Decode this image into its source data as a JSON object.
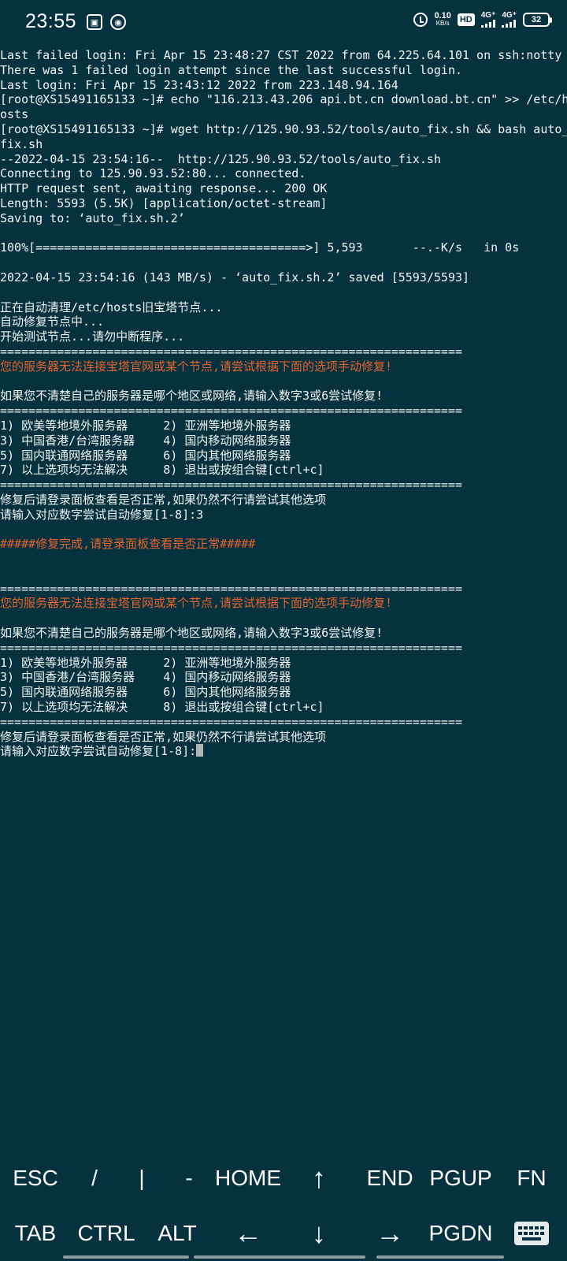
{
  "status_bar": {
    "time": "23:55",
    "net_speed_value": "0.10",
    "net_speed_unit": "KB/s",
    "hd_label": "HD",
    "sim1_label": "4G⁺",
    "sim2_label": "4G⁺",
    "battery": "32",
    "icons": [
      "image-notification-icon",
      "app-notification-icon",
      "alarm-icon",
      "hd-voice-icon",
      "signal-icon",
      "battery-icon"
    ]
  },
  "terminal": {
    "lines": [
      {
        "text": "Last failed login: Fri Apr 15 23:48:27 CST 2022 from 64.225.64.101 on ssh:notty",
        "color": "normal"
      },
      {
        "text": "There was 1 failed login attempt since the last successful login.",
        "color": "normal"
      },
      {
        "text": "Last login: Fri Apr 15 23:43:12 2022 from 223.148.94.164",
        "color": "normal"
      },
      {
        "text": "[root@XS15491165133 ~]# echo \"116.213.43.206 api.bt.cn download.bt.cn\" >> /etc/h",
        "color": "normal"
      },
      {
        "text": "osts",
        "color": "normal"
      },
      {
        "text": "[root@XS15491165133 ~]# wget http://125.90.93.52/tools/auto_fix.sh && bash auto_",
        "color": "normal"
      },
      {
        "text": "fix.sh",
        "color": "normal"
      },
      {
        "text": "--2022-04-15 23:54:16--  http://125.90.93.52/tools/auto_fix.sh",
        "color": "normal"
      },
      {
        "text": "Connecting to 125.90.93.52:80... connected.",
        "color": "normal"
      },
      {
        "text": "HTTP request sent, awaiting response... 200 OK",
        "color": "normal"
      },
      {
        "text": "Length: 5593 (5.5K) [application/octet-stream]",
        "color": "normal"
      },
      {
        "text": "Saving to: ‘auto_fix.sh.2’",
        "color": "normal"
      },
      {
        "text": "",
        "color": "normal"
      },
      {
        "text": "100%[======================================>] 5,593       --.-K/s   in 0s",
        "color": "normal"
      },
      {
        "text": "",
        "color": "normal"
      },
      {
        "text": "2022-04-15 23:54:16 (143 MB/s) - ‘auto_fix.sh.2’ saved [5593/5593]",
        "color": "normal"
      },
      {
        "text": "",
        "color": "normal"
      },
      {
        "text": "正在自动清理/etc/hosts旧宝塔节点...",
        "color": "normal"
      },
      {
        "text": "自动修复节点中...",
        "color": "normal"
      },
      {
        "text": "开始测试节点...请勿中断程序...",
        "color": "normal"
      },
      {
        "text": "=================================================================",
        "color": "normal"
      },
      {
        "text": "您的服务器无法连接宝塔官网或某个节点,请尝试根据下面的选项手动修复!",
        "color": "orange"
      },
      {
        "text": "",
        "color": "normal"
      },
      {
        "text": "如果您不清楚自己的服务器是哪个地区或网络,请输入数字3或6尝试修复!",
        "color": "normal"
      },
      {
        "text": "=================================================================",
        "color": "normal"
      },
      {
        "text": "1) 欧美等地境外服务器     2) 亚洲等地境外服务器",
        "color": "normal"
      },
      {
        "text": "3) 中国香港/台湾服务器    4) 国内移动网络服务器",
        "color": "normal"
      },
      {
        "text": "5) 国内联通网络服务器     6) 国内其他网络服务器",
        "color": "normal"
      },
      {
        "text": "7) 以上选项均无法解决     8) 退出或按组合键[ctrl+c]",
        "color": "normal"
      },
      {
        "text": "=================================================================",
        "color": "normal"
      },
      {
        "text": "修复后请登录面板查看是否正常,如果仍然不行请尝试其他选项",
        "color": "normal"
      },
      {
        "text": "请输入对应数字尝试自动修复[1-8]:3",
        "color": "normal"
      },
      {
        "text": "",
        "color": "normal"
      },
      {
        "text": "#####修复完成,请登录面板查看是否正常#####",
        "color": "orange"
      },
      {
        "text": "",
        "color": "normal"
      },
      {
        "text": "",
        "color": "normal"
      },
      {
        "text": "=================================================================",
        "color": "normal"
      },
      {
        "text": "您的服务器无法连接宝塔官网或某个节点,请尝试根据下面的选项手动修复!",
        "color": "orange"
      },
      {
        "text": "",
        "color": "normal"
      },
      {
        "text": "如果您不清楚自己的服务器是哪个地区或网络,请输入数字3或6尝试修复!",
        "color": "normal"
      },
      {
        "text": "=================================================================",
        "color": "normal"
      },
      {
        "text": "1) 欧美等地境外服务器     2) 亚洲等地境外服务器",
        "color": "normal"
      },
      {
        "text": "3) 中国香港/台湾服务器    4) 国内移动网络服务器",
        "color": "normal"
      },
      {
        "text": "5) 国内联通网络服务器     6) 国内其他网络服务器",
        "color": "normal"
      },
      {
        "text": "7) 以上选项均无法解决     8) 退出或按组合键[ctrl+c]",
        "color": "normal"
      },
      {
        "text": "=================================================================",
        "color": "normal"
      },
      {
        "text": "修复后请登录面板查看是否正常,如果仍然不行请尝试其他选项",
        "color": "normal"
      }
    ],
    "prompt_line": "请输入对应数字尝试自动修复[1-8]:",
    "colors": {
      "background": "#06323f",
      "text": "#f2f4f4",
      "warning": "#e8622c"
    }
  },
  "extra_keys": {
    "row1": [
      "ESC",
      "/",
      "|",
      "-",
      "HOME",
      "↑",
      "END",
      "PGUP",
      "FN"
    ],
    "row2": [
      "TAB",
      "CTRL",
      "ALT",
      "←",
      "↓",
      "→",
      "PGDN"
    ],
    "keyboard_toggle": "keyboard-icon"
  }
}
